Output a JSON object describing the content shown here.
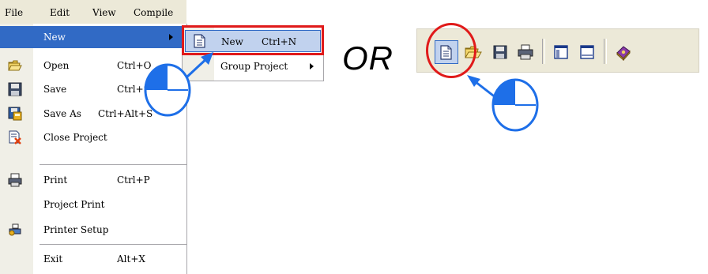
{
  "menubar": {
    "file": "File",
    "edit": "Edit",
    "view": "View",
    "compile": "Compile"
  },
  "file_menu": {
    "items": [
      {
        "label": "New",
        "shortcut": "",
        "icon": "none"
      },
      {
        "label": "Open",
        "shortcut": "Ctrl+O",
        "icon": "open-folder-icon"
      },
      {
        "label": "Save",
        "shortcut": "Ctrl+S",
        "icon": "floppy-disk-icon"
      },
      {
        "label": "Save As",
        "shortcut": "Ctrl+Alt+S",
        "icon": "save-as-icon"
      },
      {
        "label": "Close Project",
        "shortcut": "",
        "icon": "close-project-icon"
      },
      {
        "label": "Print",
        "shortcut": "Ctrl+P",
        "icon": "printer-icon"
      },
      {
        "label": "Project Print",
        "shortcut": "",
        "icon": "none"
      },
      {
        "label": "Printer Setup",
        "shortcut": "",
        "icon": "printer-setup-icon"
      },
      {
        "label": "Exit",
        "shortcut": "Alt+X",
        "icon": "none"
      }
    ]
  },
  "submenu": {
    "new_label": "New",
    "new_shortcut": "Ctrl+N",
    "group_label": "Group Project"
  },
  "or_text": "OR",
  "toolbar": {
    "buttons": [
      "new-document-icon",
      "open-folder-icon",
      "floppy-disk-icon",
      "printer-icon",
      "column-window-icon",
      "window-icon",
      "help-book-icon"
    ]
  },
  "colors": {
    "menu_highlight": "#316ac5",
    "selected_bg": "#c1d2ee",
    "callout_red": "#e01a1a",
    "pointer_blue": "#1e6fe8",
    "menu_bg": "#ece9d8"
  }
}
